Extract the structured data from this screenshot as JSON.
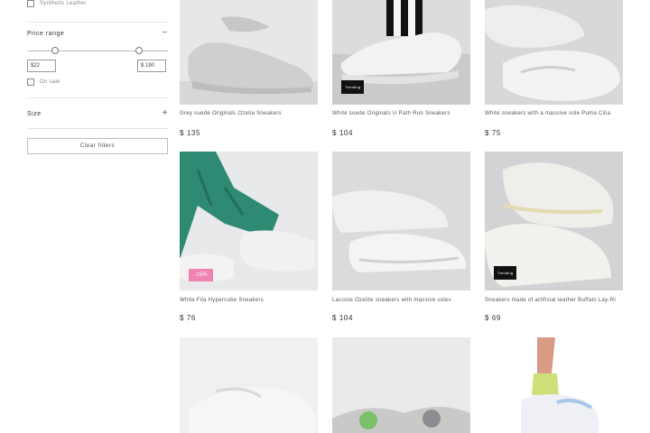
{
  "sidebar": {
    "top_checkbox_label": "Synthetic Leather",
    "price_range": {
      "label": "Price range",
      "toggle": "−",
      "min_value": "$22",
      "max_value": "$ 190"
    },
    "on_sale_label": "On sale",
    "size": {
      "label": "Size",
      "toggle": "+"
    },
    "clear_filters_label": "Clear filters"
  },
  "products": [
    {
      "name": "Grey suede Originals Ozelia Sneakers",
      "price": "$ 135",
      "badge": ""
    },
    {
      "name": "White suede Originals U Path Run Sneakers",
      "price": "$ 104",
      "badge": "Trending"
    },
    {
      "name": "White sneakers with a massive sole Puma Cilia",
      "price": "$ 75",
      "badge": ""
    },
    {
      "name": "White Fila Hypercube Sneakers",
      "price": "$ 76",
      "badge": "-15%"
    },
    {
      "name": "Lacoste Ozelite sneakers with massive soles",
      "price": "$ 104",
      "badge": ""
    },
    {
      "name": "Sneakers made of artificial leather Buffalo Lay-Ri",
      "price": "$ 69",
      "badge": "Trending"
    },
    {
      "name": "",
      "price": "",
      "badge": ""
    },
    {
      "name": "",
      "price": "",
      "badge": ""
    },
    {
      "name": "",
      "price": "",
      "badge": ""
    }
  ],
  "colors": {
    "photo_bg_light": "#eceff0",
    "photo_bg_grey": "#d9dadb",
    "sale_badge": "#f083b2",
    "dark_badge": "#111111",
    "green_pants": "#2f8a73"
  },
  "icons": {
    "minus": "minus-icon",
    "plus": "plus-icon",
    "checkbox": "checkbox-icon"
  }
}
